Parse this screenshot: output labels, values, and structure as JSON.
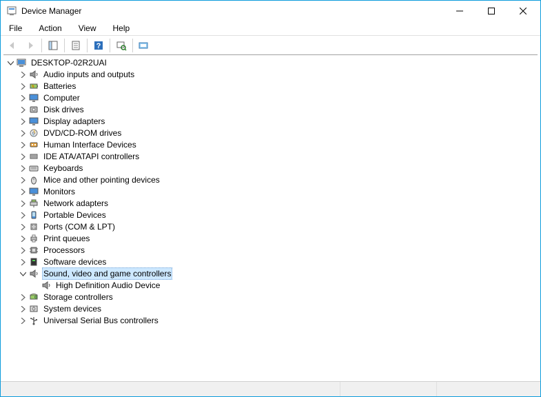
{
  "window": {
    "title": "Device Manager"
  },
  "menus": {
    "file": "File",
    "action": "Action",
    "view": "View",
    "help": "Help"
  },
  "tree": {
    "root": "DESKTOP-02R2UAI",
    "items": [
      {
        "label": "Audio inputs and outputs",
        "icon": "speaker"
      },
      {
        "label": "Batteries",
        "icon": "battery"
      },
      {
        "label": "Computer",
        "icon": "monitor"
      },
      {
        "label": "Disk drives",
        "icon": "disk"
      },
      {
        "label": "Display adapters",
        "icon": "monitor"
      },
      {
        "label": "DVD/CD-ROM drives",
        "icon": "cd"
      },
      {
        "label": "Human Interface Devices",
        "icon": "hid"
      },
      {
        "label": "IDE ATA/ATAPI controllers",
        "icon": "ide"
      },
      {
        "label": "Keyboards",
        "icon": "keyboard"
      },
      {
        "label": "Mice and other pointing devices",
        "icon": "mouse"
      },
      {
        "label": "Monitors",
        "icon": "monitor"
      },
      {
        "label": "Network adapters",
        "icon": "network"
      },
      {
        "label": "Portable Devices",
        "icon": "portable"
      },
      {
        "label": "Ports (COM & LPT)",
        "icon": "port"
      },
      {
        "label": "Print queues",
        "icon": "printer"
      },
      {
        "label": "Processors",
        "icon": "cpu"
      },
      {
        "label": "Software devices",
        "icon": "software"
      },
      {
        "label": "Sound, video and game controllers",
        "icon": "speaker",
        "expanded": true,
        "selected": true,
        "children": [
          {
            "label": "High Definition Audio Device",
            "icon": "speaker"
          }
        ]
      },
      {
        "label": "Storage controllers",
        "icon": "storage"
      },
      {
        "label": "System devices",
        "icon": "system"
      },
      {
        "label": "Universal Serial Bus controllers",
        "icon": "usb"
      }
    ]
  }
}
